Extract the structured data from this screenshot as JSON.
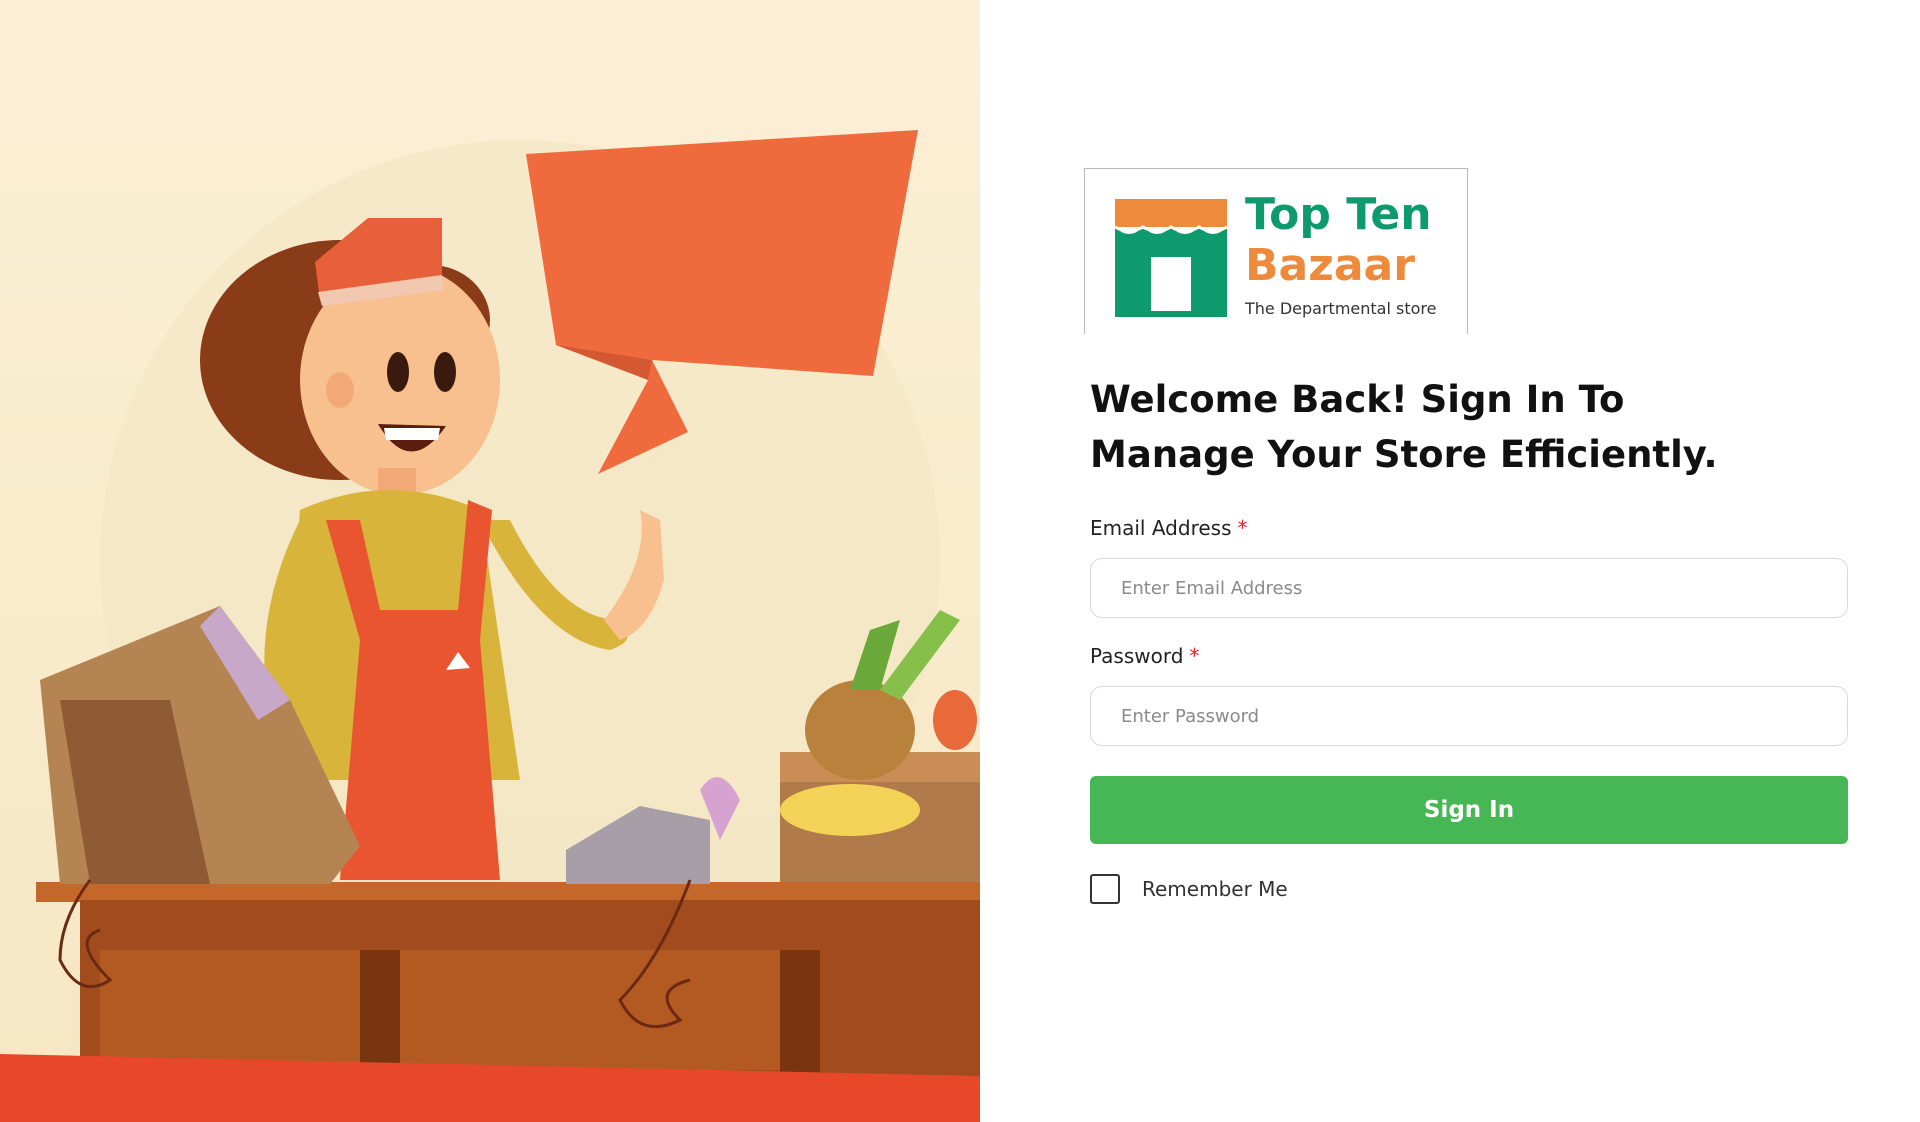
{
  "brand": {
    "line1": "Top Ten",
    "line2": "Bazaar",
    "tagline": "The Departmental store",
    "colors": {
      "primary": "#0f9a6e",
      "secondary": "#ee8a3c"
    }
  },
  "headline": "Welcome Back! Sign In To Manage Your Store Efficiently.",
  "form": {
    "email": {
      "label": "Email Address",
      "required_mark": "*",
      "placeholder": "Enter Email Address",
      "value": ""
    },
    "password": {
      "label": "Password",
      "required_mark": "*",
      "placeholder": "Enter Password",
      "value": ""
    },
    "submit_label": "Sign In",
    "remember": {
      "label": "Remember Me",
      "checked": false
    }
  },
  "colors": {
    "accent": "#47b655",
    "required": "#e0242b",
    "speech_bubble": "#ef6b3e"
  },
  "icons": [
    "storefront-icon",
    "checkbox-icon"
  ]
}
